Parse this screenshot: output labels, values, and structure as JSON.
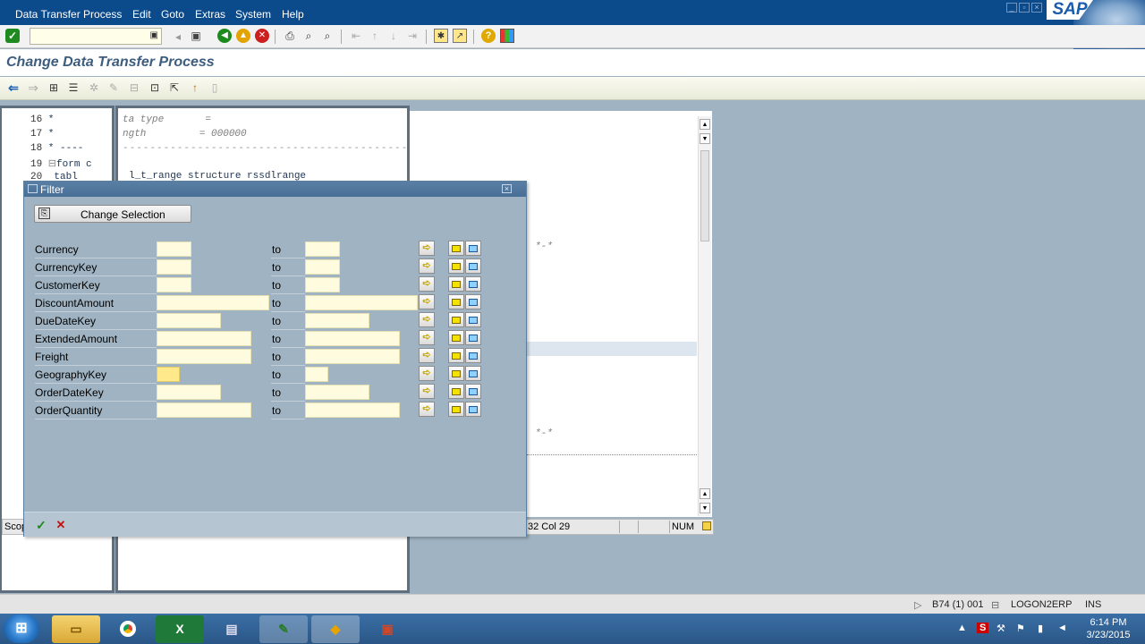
{
  "menubar": {
    "items": [
      "Data Transfer Process",
      "Edit",
      "Goto",
      "Extras",
      "System",
      "Help"
    ],
    "logo": "SAP"
  },
  "systoolbar": {
    "okcode_value": "",
    "icons": [
      "enter-icon",
      "back-icon",
      "save-icon",
      "back-green-icon",
      "exit-icon",
      "cancel-icon",
      "print-icon",
      "find-icon",
      "find-next-icon",
      "first-page-icon",
      "prev-page-icon",
      "next-page-icon",
      "last-page-icon",
      "new-session-icon",
      "shortcut-icon",
      "help-icon",
      "layout-icon"
    ]
  },
  "title": "Change Data Transfer Process",
  "editor": {
    "lines": [
      {
        "num": "16",
        "text": " *"
      },
      {
        "num": "17",
        "text": " *"
      },
      {
        "num": "18",
        "text": " * ----"
      },
      {
        "num": "19",
        "text": "form c"
      },
      {
        "num": "20",
        "text": "  tabl"
      }
    ],
    "mid_lines": [
      "ta type       =",
      "ngth         = 000000"
    ],
    "code_line": "l_t_range structure rssdlrange",
    "comment_marks": [
      "*-*",
      "*-*"
    ],
    "status_pos": "32 Col 29",
    "status_num": "NUM",
    "scope": "Scop"
  },
  "dialog": {
    "title": "Filter",
    "change_selection": "Change Selection",
    "rows": [
      {
        "name": "Currency",
        "to": "to"
      },
      {
        "name": "CurrencyKey",
        "to": "to"
      },
      {
        "name": "CustomerKey",
        "to": "to"
      },
      {
        "name": "DiscountAmount",
        "to": "to"
      },
      {
        "name": "DueDateKey",
        "to": "to"
      },
      {
        "name": "ExtendedAmount",
        "to": "to"
      },
      {
        "name": "Freight",
        "to": "to"
      },
      {
        "name": "GeographyKey",
        "to": "to"
      },
      {
        "name": "OrderDateKey",
        "to": "to"
      },
      {
        "name": "OrderQuantity",
        "to": "to"
      }
    ]
  },
  "statusbar": {
    "system": "B74 (1) 001",
    "server": "LOGON2ERP",
    "mode": "INS"
  },
  "taskbar": {
    "apps": [
      "file-explorer",
      "chrome",
      "excel",
      "sap-logon",
      "notepad",
      "sap-gui",
      "powerpoint"
    ],
    "time": "6:14 PM",
    "date": "3/23/2015"
  },
  "colors": {
    "menubar": "#0b4a8b",
    "dialog_bg": "#9fb3c2",
    "input_bg": "#fffbde",
    "title_text": "#3d5d7e"
  }
}
